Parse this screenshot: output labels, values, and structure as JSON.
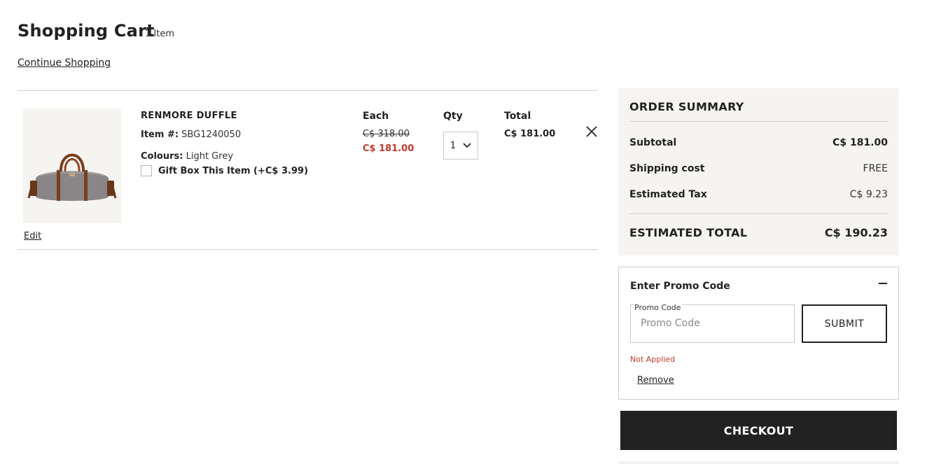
{
  "header": {
    "title": "Shopping Cart",
    "item_count": "1 Item",
    "continue_link": "Continue Shopping"
  },
  "cart": {
    "columns": {
      "each": "Each",
      "qty": "Qty",
      "total": "Total"
    },
    "items": [
      {
        "name": "RENMORE DUFFLE",
        "item_number_label": "Item #:",
        "item_number": "SBG1240050",
        "colour_label": "Colours:",
        "colour": "Light Grey",
        "gift_label": "Gift Box This Item (+C$ 3.99)",
        "gift_checked": false,
        "price_original": "C$ 318.00",
        "price_sale": "C$ 181.00",
        "qty": "1",
        "total": "C$ 181.00",
        "edit_label": "Edit"
      }
    ]
  },
  "summary": {
    "title": "ORDER SUMMARY",
    "subtotal_label": "Subtotal",
    "subtotal": "C$ 181.00",
    "shipping_label": "Shipping cost",
    "shipping": "FREE",
    "tax_label": "Estimated Tax",
    "tax": "C$ 9.23",
    "total_label": "ESTIMATED TOTAL",
    "total": "C$ 190.23"
  },
  "promo": {
    "title": "Enter Promo Code",
    "field_label": "Promo Code",
    "placeholder": "Promo Code",
    "submit_label": "SUBMIT",
    "status": "Not Applied",
    "remove_label": "Remove"
  },
  "checkout": {
    "label": "CHECKOUT"
  },
  "colors": {
    "sale_red": "#c0392b",
    "summary_bg": "#f6f4f1",
    "checkout_bg": "#222222"
  },
  "icons": [
    "duffle-bag-image",
    "chevron-down-icon",
    "close-icon",
    "minus-icon"
  ]
}
